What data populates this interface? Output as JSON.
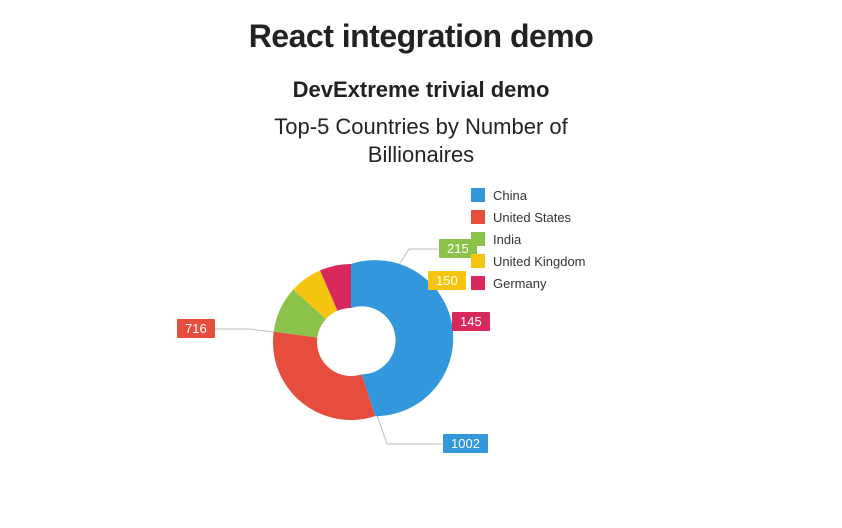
{
  "page_title": "React integration demo",
  "section_title": "DevExtreme trivial demo",
  "chart_data": {
    "type": "pie",
    "title": "Top-5 Countries by Number of Billionaires",
    "series": [
      {
        "name": "China",
        "value": 1002,
        "color": "#3398db"
      },
      {
        "name": "United States",
        "value": 716,
        "color": "#e74d3c"
      },
      {
        "name": "India",
        "value": 215,
        "color": "#8bc34a"
      },
      {
        "name": "United Kingdom",
        "value": 150,
        "color": "#f4c40f"
      },
      {
        "name": "Germany",
        "value": 145,
        "color": "#d7295c"
      }
    ],
    "donut": true,
    "legend_position": "right"
  },
  "labels": {
    "china": "1002",
    "us": "716",
    "india": "215",
    "uk": "150",
    "germany": "145"
  }
}
